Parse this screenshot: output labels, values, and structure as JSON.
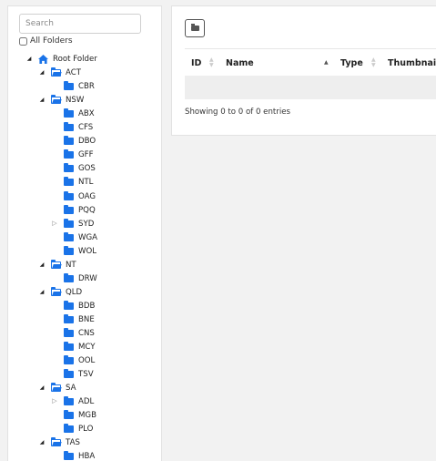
{
  "sidebar": {
    "search_placeholder": "Search",
    "all_folders_label": "All Folders",
    "tree": [
      {
        "label": "Root Folder",
        "type": "home",
        "level": 0,
        "toggle": "open"
      },
      {
        "label": "ACT",
        "type": "folder-open",
        "level": 1,
        "toggle": "open"
      },
      {
        "label": "CBR",
        "type": "folder",
        "level": 2,
        "toggle": ""
      },
      {
        "label": "NSW",
        "type": "folder-open",
        "level": 1,
        "toggle": "open"
      },
      {
        "label": "ABX",
        "type": "folder",
        "level": 2,
        "toggle": ""
      },
      {
        "label": "CFS",
        "type": "folder",
        "level": 2,
        "toggle": ""
      },
      {
        "label": "DBO",
        "type": "folder",
        "level": 2,
        "toggle": ""
      },
      {
        "label": "GFF",
        "type": "folder",
        "level": 2,
        "toggle": ""
      },
      {
        "label": "GOS",
        "type": "folder",
        "level": 2,
        "toggle": ""
      },
      {
        "label": "NTL",
        "type": "folder",
        "level": 2,
        "toggle": ""
      },
      {
        "label": "OAG",
        "type": "folder",
        "level": 2,
        "toggle": ""
      },
      {
        "label": "PQQ",
        "type": "folder",
        "level": 2,
        "toggle": ""
      },
      {
        "label": "SYD",
        "type": "folder",
        "level": 2,
        "toggle": "closed"
      },
      {
        "label": "WGA",
        "type": "folder",
        "level": 2,
        "toggle": ""
      },
      {
        "label": "WOL",
        "type": "folder",
        "level": 2,
        "toggle": ""
      },
      {
        "label": "NT",
        "type": "folder-open",
        "level": 1,
        "toggle": "open"
      },
      {
        "label": "DRW",
        "type": "folder",
        "level": 2,
        "toggle": ""
      },
      {
        "label": "QLD",
        "type": "folder-open",
        "level": 1,
        "toggle": "open"
      },
      {
        "label": "BDB",
        "type": "folder",
        "level": 2,
        "toggle": ""
      },
      {
        "label": "BNE",
        "type": "folder",
        "level": 2,
        "toggle": ""
      },
      {
        "label": "CNS",
        "type": "folder",
        "level": 2,
        "toggle": ""
      },
      {
        "label": "MCY",
        "type": "folder",
        "level": 2,
        "toggle": ""
      },
      {
        "label": "OOL",
        "type": "folder",
        "level": 2,
        "toggle": ""
      },
      {
        "label": "TSV",
        "type": "folder",
        "level": 2,
        "toggle": ""
      },
      {
        "label": "SA",
        "type": "folder-open",
        "level": 1,
        "toggle": "open"
      },
      {
        "label": "ADL",
        "type": "folder",
        "level": 2,
        "toggle": "closed"
      },
      {
        "label": "MGB",
        "type": "folder",
        "level": 2,
        "toggle": ""
      },
      {
        "label": "PLO",
        "type": "folder",
        "level": 2,
        "toggle": ""
      },
      {
        "label": "TAS",
        "type": "folder-open",
        "level": 1,
        "toggle": "open"
      },
      {
        "label": "HBA",
        "type": "folder",
        "level": 2,
        "toggle": ""
      }
    ]
  },
  "table": {
    "columns": [
      {
        "label": "ID",
        "sort": "none"
      },
      {
        "label": "Name",
        "sort": "asc"
      },
      {
        "label": "Type",
        "sort": "none"
      },
      {
        "label": "Thumbnail",
        "sort": "none"
      }
    ],
    "info": "Showing 0 to 0 of 0 entries"
  },
  "colors": {
    "folder": "#1a73e8",
    "header_border": "#dddddd",
    "empty_row": "#eeeeee"
  }
}
